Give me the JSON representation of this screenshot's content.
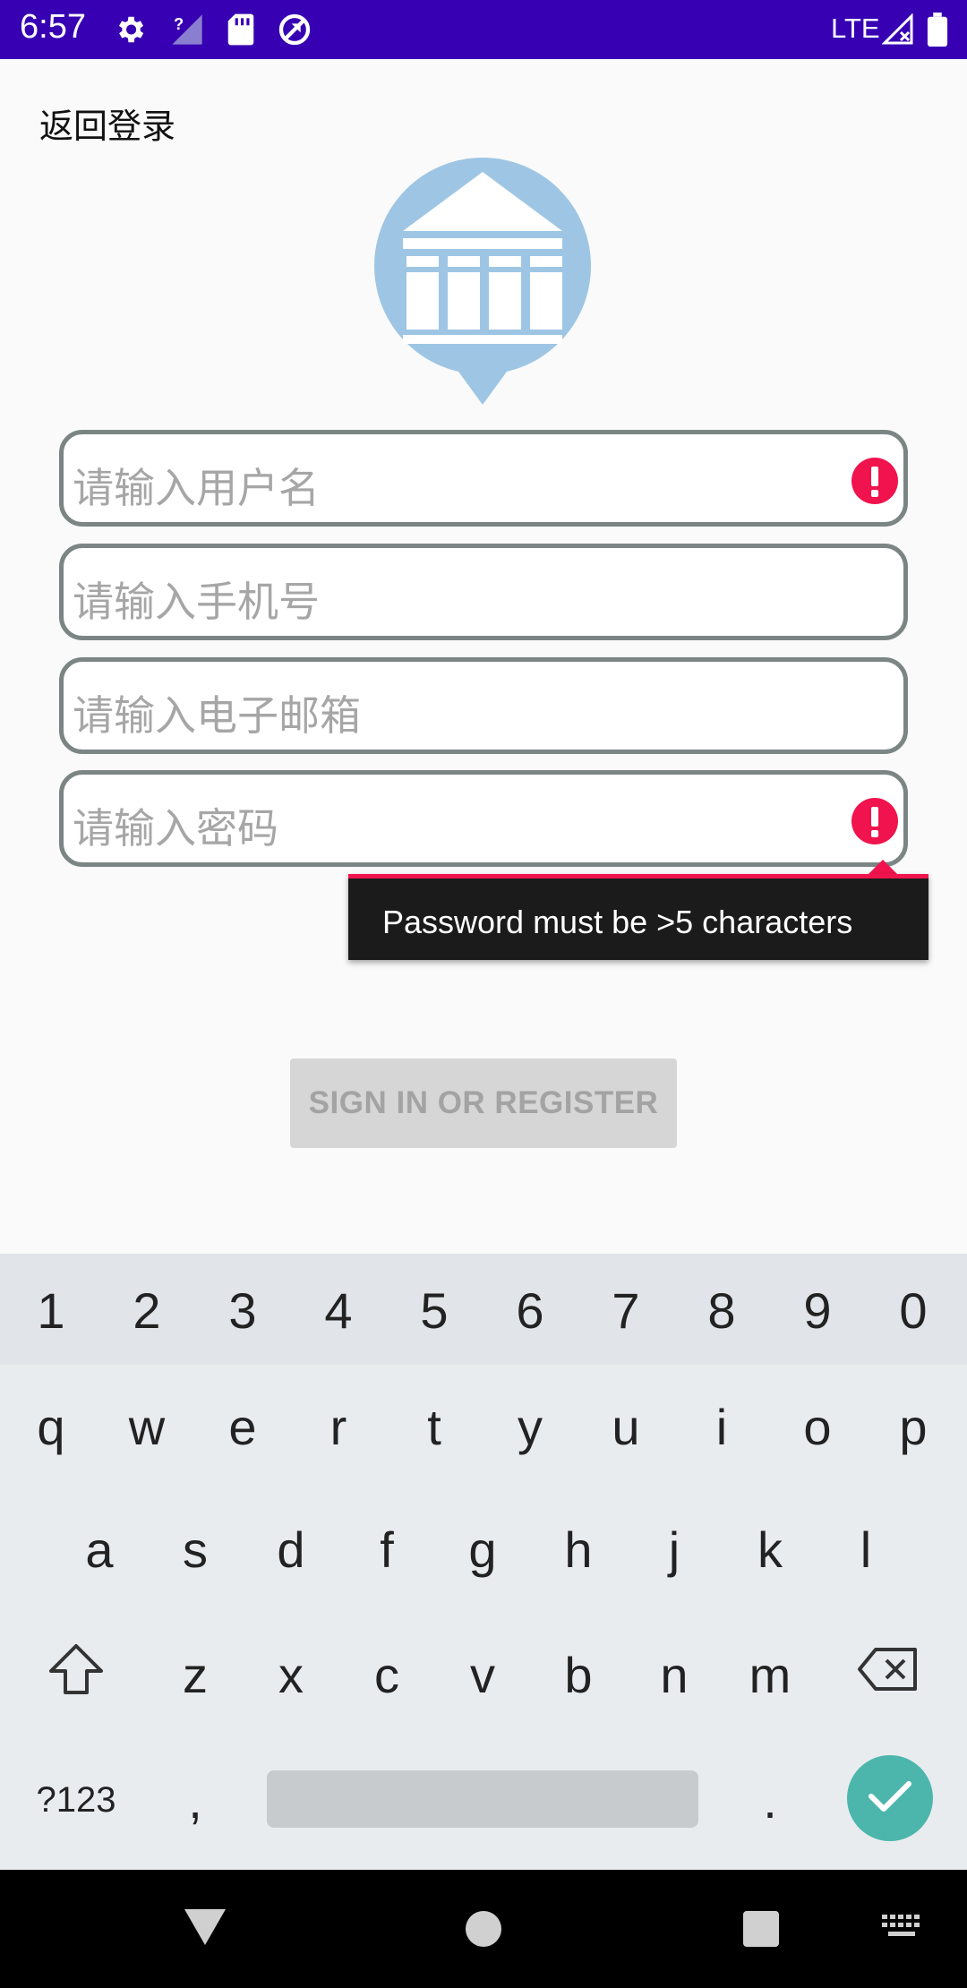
{
  "status_bar": {
    "time": "6:57",
    "network": "LTE",
    "icons": [
      "gear-icon",
      "signal-question-icon",
      "sd-card-icon",
      "sync-disabled-icon",
      "signal-x-icon",
      "battery-icon"
    ]
  },
  "header": {
    "back_label": "返回登录"
  },
  "logo": {
    "name": "bank-building-logo",
    "color": "#9ec6e4"
  },
  "form": {
    "username_placeholder": "请输入用户名",
    "phone_placeholder": "请输入手机号",
    "email_placeholder": "请输入电子邮箱",
    "password_placeholder": "请输入密码",
    "error_color": "#f0134d"
  },
  "tooltip": {
    "text": "Password must be >5 characters"
  },
  "buttons": {
    "signin_label": "SIGN IN OR REGISTER"
  },
  "keyboard": {
    "numbers": [
      "1",
      "2",
      "3",
      "4",
      "5",
      "6",
      "7",
      "8",
      "9",
      "0"
    ],
    "row1": [
      "q",
      "w",
      "e",
      "r",
      "t",
      "y",
      "u",
      "i",
      "o",
      "p"
    ],
    "row2": [
      "a",
      "s",
      "d",
      "f",
      "g",
      "h",
      "j",
      "k",
      "l"
    ],
    "row3": [
      "z",
      "x",
      "c",
      "v",
      "b",
      "n",
      "m"
    ],
    "symbols_label": "?123",
    "comma": ",",
    "period": ".",
    "enter_color": "#4db6ac"
  },
  "nav": {
    "icons": [
      "back-triangle-icon",
      "home-circle-icon",
      "recents-square-icon",
      "keyboard-icon"
    ]
  }
}
